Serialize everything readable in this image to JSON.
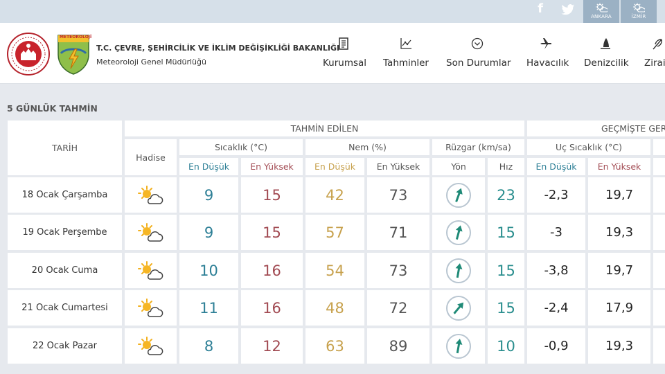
{
  "topbar": {
    "cities": [
      {
        "label": "ANKARA"
      },
      {
        "label": "İZMİR"
      }
    ]
  },
  "header": {
    "ministry": "T.C. ÇEVRE, ŞEHİRCİLİK VE İKLİM DEĞİŞİKLİĞİ BAKANLIĞI",
    "subtitle": "Meteoroloji Genel Müdürlüğü",
    "logo_text": "METEOROLOJİ",
    "nav": [
      {
        "label": "Kurumsal",
        "icon": "document-icon"
      },
      {
        "label": "Tahminler",
        "icon": "chart-icon"
      },
      {
        "label": "Son Durumlar",
        "icon": "check-circle-icon"
      },
      {
        "label": "Havacılık",
        "icon": "airplane-icon"
      },
      {
        "label": "Denizcilik",
        "icon": "sail-icon"
      },
      {
        "label": "Zirai",
        "icon": "leaf-icon"
      }
    ]
  },
  "forecast": {
    "title": "5 GÜNLÜK TAHMİN",
    "headers": {
      "date": "TARİH",
      "predicted": "TAHMİN EDİLEN",
      "past": "GEÇMİŞTE GER",
      "hadise": "Hadise",
      "temp": "Sıcaklık (°C)",
      "humidity": "Nem (%)",
      "wind": "Rüzgar (km/sa)",
      "extreme": "Uç Sıcaklık (°C)",
      "min": "En Düşük",
      "max": "En Yüksek",
      "dir": "Yön",
      "speed": "Hız"
    },
    "colors": {
      "blue": "#2d7f96",
      "red": "#a24b53",
      "gold": "#c7a14d",
      "teal": "#2a8e8e"
    },
    "rows": [
      {
        "date": "18 Ocak Çarşamba",
        "icon": "partly-cloudy-icon",
        "t_min": "9",
        "t_max": "15",
        "h_min": "42",
        "h_max": "73",
        "wind_dir": 20,
        "wind_speed": "23",
        "ext_min": "-2,3",
        "ext_max": "19,7"
      },
      {
        "date": "19 Ocak Perşembe",
        "icon": "partly-cloudy-icon",
        "t_min": "9",
        "t_max": "15",
        "h_min": "57",
        "h_max": "71",
        "wind_dir": 15,
        "wind_speed": "15",
        "ext_min": "-3",
        "ext_max": "19,3"
      },
      {
        "date": "20 Ocak Cuma",
        "icon": "partly-cloudy-icon",
        "t_min": "10",
        "t_max": "16",
        "h_min": "54",
        "h_max": "73",
        "wind_dir": 10,
        "wind_speed": "15",
        "ext_min": "-3,8",
        "ext_max": "19,7"
      },
      {
        "date": "21 Ocak Cumartesi",
        "icon": "partly-cloudy-icon",
        "t_min": "11",
        "t_max": "16",
        "h_min": "48",
        "h_max": "72",
        "wind_dir": 40,
        "wind_speed": "15",
        "ext_min": "-2,4",
        "ext_max": "17,9"
      },
      {
        "date": "22 Ocak Pazar",
        "icon": "partly-cloudy-icon",
        "t_min": "8",
        "t_max": "12",
        "h_min": "63",
        "h_max": "89",
        "wind_dir": 10,
        "wind_speed": "10",
        "ext_min": "-0,9",
        "ext_max": "19,3"
      }
    ]
  }
}
